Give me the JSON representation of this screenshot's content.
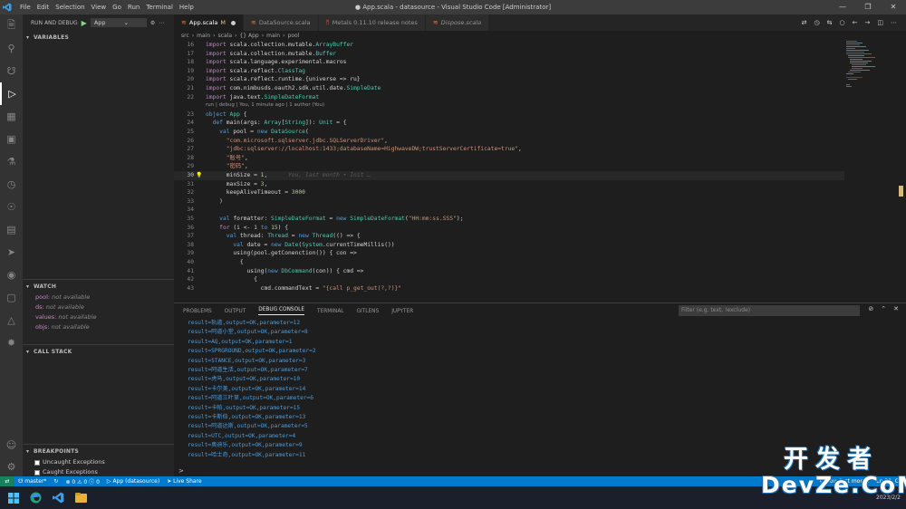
{
  "titlebar": {
    "menu": [
      "File",
      "Edit",
      "Selection",
      "View",
      "Go",
      "Run",
      "Terminal",
      "Help"
    ],
    "title": "● App.scala - datasource - Visual Studio Code [Administrator]"
  },
  "sidebar": {
    "run_label": "RUN AND DEBUG",
    "config": "App",
    "variables_label": "VARIABLES",
    "watch_label": "WATCH",
    "watch_items": [
      {
        "key": "pool:",
        "value": "not available"
      },
      {
        "key": "ds:",
        "value": "not available"
      },
      {
        "key": "values:",
        "value": "not available"
      },
      {
        "key": "objs:",
        "value": "not available"
      }
    ],
    "callstack_label": "CALL STACK",
    "breakpoints_label": "BREAKPOINTS",
    "breakpoints": [
      "Uncaught Exceptions",
      "Caught Exceptions"
    ]
  },
  "tabs": [
    {
      "label": "App.scala",
      "mark": "M",
      "active": true,
      "icon": "scala-icon"
    },
    {
      "label": "DataSource.scala",
      "active": false,
      "icon": "scala-icon"
    },
    {
      "label": "Metals 0.11.10 release notes",
      "active": false,
      "icon": "metals-icon"
    },
    {
      "label": "Dispose.scala",
      "active": false,
      "italic": true,
      "icon": "scala-icon"
    }
  ],
  "breadcrumb": [
    "src",
    "main",
    "scala",
    "{} App",
    "main",
    "pool"
  ],
  "editor": {
    "lines": [
      {
        "n": "16",
        "code": "import scala.collection.mutable.ArrayBuffer"
      },
      {
        "n": "17",
        "code": "import scala.collection.mutable.Buffer"
      },
      {
        "n": "18",
        "code": "import scala.language.experimental.macros"
      },
      {
        "n": "19",
        "code": "import scala.reflect.ClassTag"
      },
      {
        "n": "20",
        "code": "import scala.reflect.runtime.{universe => ru}"
      },
      {
        "n": "21",
        "code": "import com.nimbusds.oauth2.sdk.util.date.SimpleDate"
      },
      {
        "n": "22",
        "code": "import java.text.SimpleDateFormat"
      },
      {
        "n": "",
        "lens": "run | debug | You, 1 minute ago | 1 author (You)"
      },
      {
        "n": "23",
        "code": "object App {"
      },
      {
        "n": "24",
        "code": "  def main(args: Array[String]): Unit = {"
      },
      {
        "n": "25",
        "code": "    val pool = new DataSource("
      },
      {
        "n": "26",
        "code": "      \"com.microsoft.sqlserver.jdbc.SQLServerDriver\","
      },
      {
        "n": "27",
        "code": "      \"jdbc:sqlserver://localhost:1433;databaseName=HighwaveDW;trustServerCertificate=true\","
      },
      {
        "n": "28",
        "code": "      \"账号\","
      },
      {
        "n": "29",
        "code": "      \"密码\","
      },
      {
        "n": "30",
        "code": "      minSize = 1,",
        "ghost": "You, last month • Init …",
        "current": true
      },
      {
        "n": "31",
        "code": "      maxSize = 3,"
      },
      {
        "n": "32",
        "code": "      keepAliveTimeout = 3000"
      },
      {
        "n": "33",
        "code": "    )"
      },
      {
        "n": "34",
        "code": ""
      },
      {
        "n": "35",
        "code": "    val formatter: SimpleDateFormat = new SimpleDateFormat(\"HH:mm:ss.SSS\");"
      },
      {
        "n": "36",
        "code": "    for (i <- 1 to 15) {"
      },
      {
        "n": "37",
        "code": "      val thread: Thread = new Thread(() => {"
      },
      {
        "n": "38",
        "code": "        val date = new Date(System.currentTimeMillis())"
      },
      {
        "n": "39",
        "code": "        using(pool.getConenction()) { con =>"
      },
      {
        "n": "40",
        "code": "          {"
      },
      {
        "n": "41",
        "code": "            using(new DbCommand(con)) { cmd =>"
      },
      {
        "n": "42",
        "code": "              {"
      },
      {
        "n": "43",
        "code": "                cmd.commandText = \"{call p_get_out(?,?)}\""
      }
    ]
  },
  "panel": {
    "tabs": [
      "PROBLEMS",
      "OUTPUT",
      "DEBUG CONSOLE",
      "TERMINAL",
      "GITLENS",
      "JUPYTER"
    ],
    "active_tab": "DEBUG CONSOLE",
    "filter_placeholder": "Filter (e.g. text, !exclude)",
    "output": [
      "result=轨道,output=OK,parameter=12",
      "result=阿道小堂,output=OK,parameter=8",
      "result=AQ,output=OK,parameter=1",
      "result=SPRGROUND,output=OK,parameter=2",
      "result=STANCE,output=OK,parameter=3",
      "result=阿道生活,output=OK,parameter=7",
      "result=虎马,output=OK,parameter=10",
      "result=卡尔美,output=OK,parameter=14",
      "result=阿道三叶草,output=OK,parameter=6",
      "result=卡帕,output=OK,parameter=15",
      "result=卡斯伯,output=OK,parameter=13",
      "result=阿道达斯,output=OK,parameter=5",
      "result=UTC,output=OK,parameter=4",
      "result=奥迪乐,output=OK,parameter=9",
      "result=哈士奇,output=OK,parameter=11"
    ],
    "prompt": ">"
  },
  "statusbar": {
    "branch": "master*",
    "errors": "0",
    "warnings": "0",
    "info": "0",
    "debug_target": "App (datasource)",
    "live_share": "Live Share",
    "blame": "You, last month",
    "position": "Ln 30, C"
  },
  "watermark": {
    "line1": "开发者",
    "line2": "DevZe.CoM",
    "date": "2023/2/2"
  },
  "colors": {
    "statusbar": "#007acc",
    "output_text": "#4d9bd8",
    "activity_bar": "#333333"
  }
}
